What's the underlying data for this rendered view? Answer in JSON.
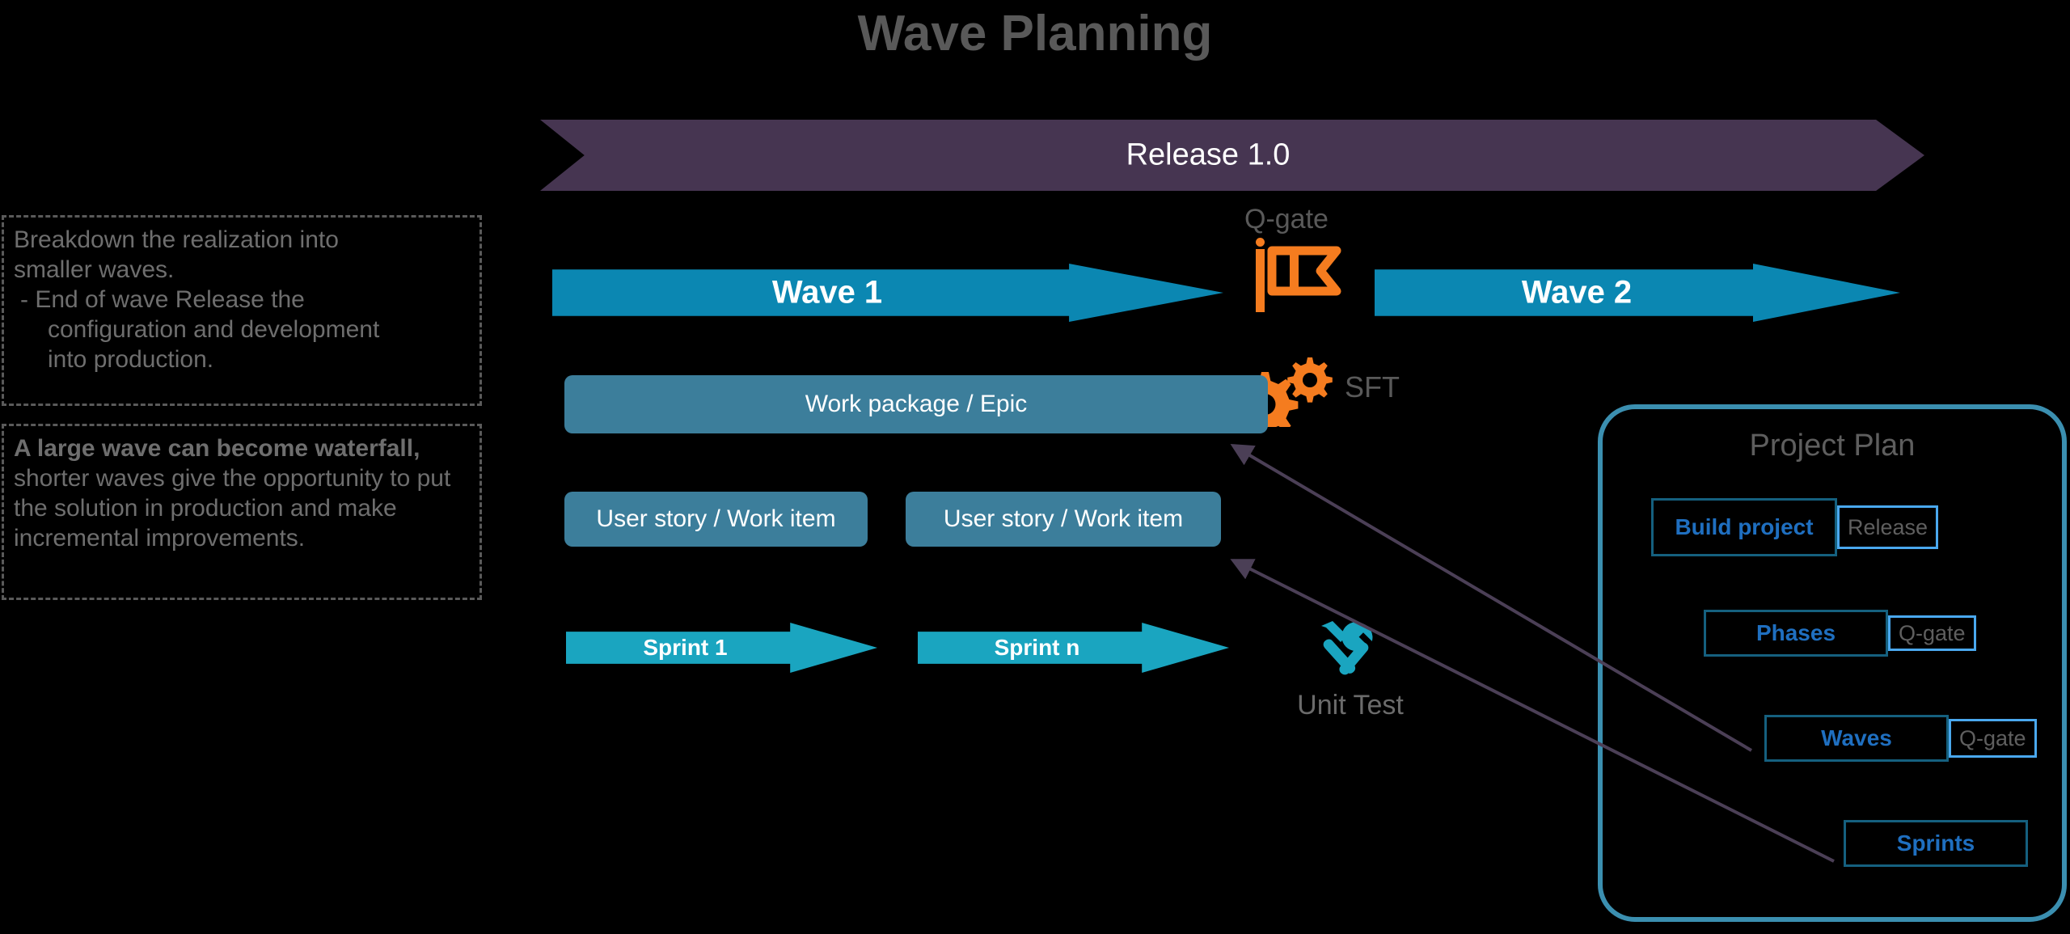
{
  "page": {
    "title": "Wave Planning",
    "title_color": "#595959",
    "background": "#000000"
  },
  "release": {
    "label": "Release 1.0",
    "color": "#463551"
  },
  "waves": [
    {
      "label": "Wave 1",
      "color": "#0b87b2"
    },
    {
      "label": "Wave 2",
      "color": "#0b87b2"
    }
  ],
  "markers": {
    "qgate": {
      "label": "Q-gate",
      "icon": "flag-icon",
      "color": "#f57c1f"
    },
    "sft": {
      "label": "SFT",
      "icon": "gears-icon",
      "color": "#f57c1f"
    },
    "unit_test": {
      "label": "Unit Test",
      "icon": "tools-icon",
      "color": "#1aa5c0"
    }
  },
  "work_items": {
    "work_package": "Work package / Epic",
    "user_story_1": "User story / Work item",
    "user_story_2": "User story / Work item",
    "color": "#3c7e9b"
  },
  "sprints": [
    {
      "label": "Sprint 1",
      "color": "#1aa5c0"
    },
    {
      "label": "Sprint n",
      "color": "#1aa5c0"
    }
  ],
  "notes": [
    {
      "line1": "Breakdown the realization into",
      "line2": "smaller waves.",
      "line3": "-  End of wave Release the",
      "line4": "configuration and development",
      "line5": "into production."
    },
    {
      "bold": "A large wave can become waterfall,",
      "rest": " shorter waves give the opportunity to put the solution in production and make incremental improvements."
    }
  ],
  "project_plan": {
    "title": "Project Plan",
    "border_color": "#3b8fb0",
    "rows": [
      {
        "label": "Build project",
        "gate": "Release"
      },
      {
        "label": "Phases",
        "gate": "Q-gate"
      },
      {
        "label": "Waves",
        "gate": "Q-gate"
      },
      {
        "label": "Sprints",
        "gate": ""
      }
    ]
  }
}
